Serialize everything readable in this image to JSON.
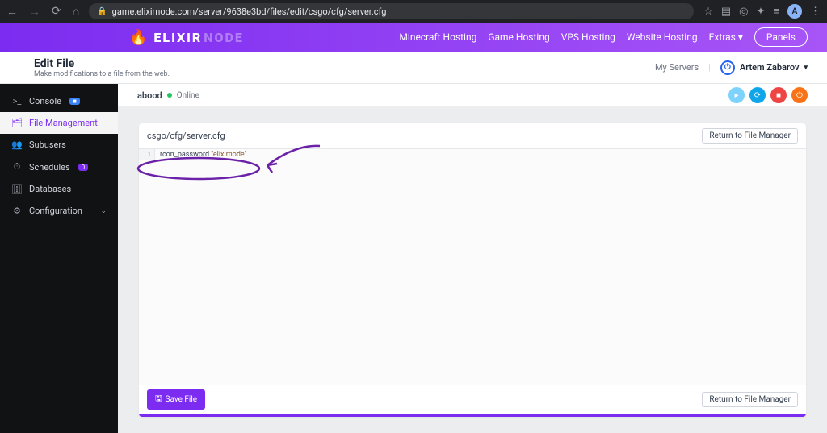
{
  "browser": {
    "url": "game.elixirnode.com/server/9638e3bd/files/edit/csgo/cfg/server.cfg",
    "avatar_letter": "A"
  },
  "brand": {
    "main": "ELIXIR",
    "accent": "NODE"
  },
  "topnav": {
    "links": [
      "Minecraft Hosting",
      "Game Hosting",
      "VPS Hosting",
      "Website Hosting",
      "Extras"
    ],
    "panels": "Panels"
  },
  "page": {
    "title": "Edit File",
    "subtitle": "Make modifications to a file from the web.",
    "my_servers": "My Servers",
    "user_name": "Artem Zabarov"
  },
  "sidebar": {
    "items": [
      {
        "icon": ">_",
        "label": "Console",
        "badge": "■"
      },
      {
        "icon": "🗂",
        "label": "File Management",
        "active": true
      },
      {
        "icon": "👥",
        "label": "Subusers"
      },
      {
        "icon": "⏱",
        "label": "Schedules",
        "badge": "0"
      },
      {
        "icon": "🗄",
        "label": "Databases"
      },
      {
        "icon": "⚙",
        "label": "Configuration",
        "chevron": true
      }
    ]
  },
  "server": {
    "name": "abood",
    "status": "Online"
  },
  "editor": {
    "file_path": "csgo/cfg/server.cfg",
    "return_label": "Return to File Manager",
    "save_label": "Save File",
    "line_number": "1",
    "code_cmd": "rcon_password ",
    "code_val": "\"elixirnode\""
  }
}
